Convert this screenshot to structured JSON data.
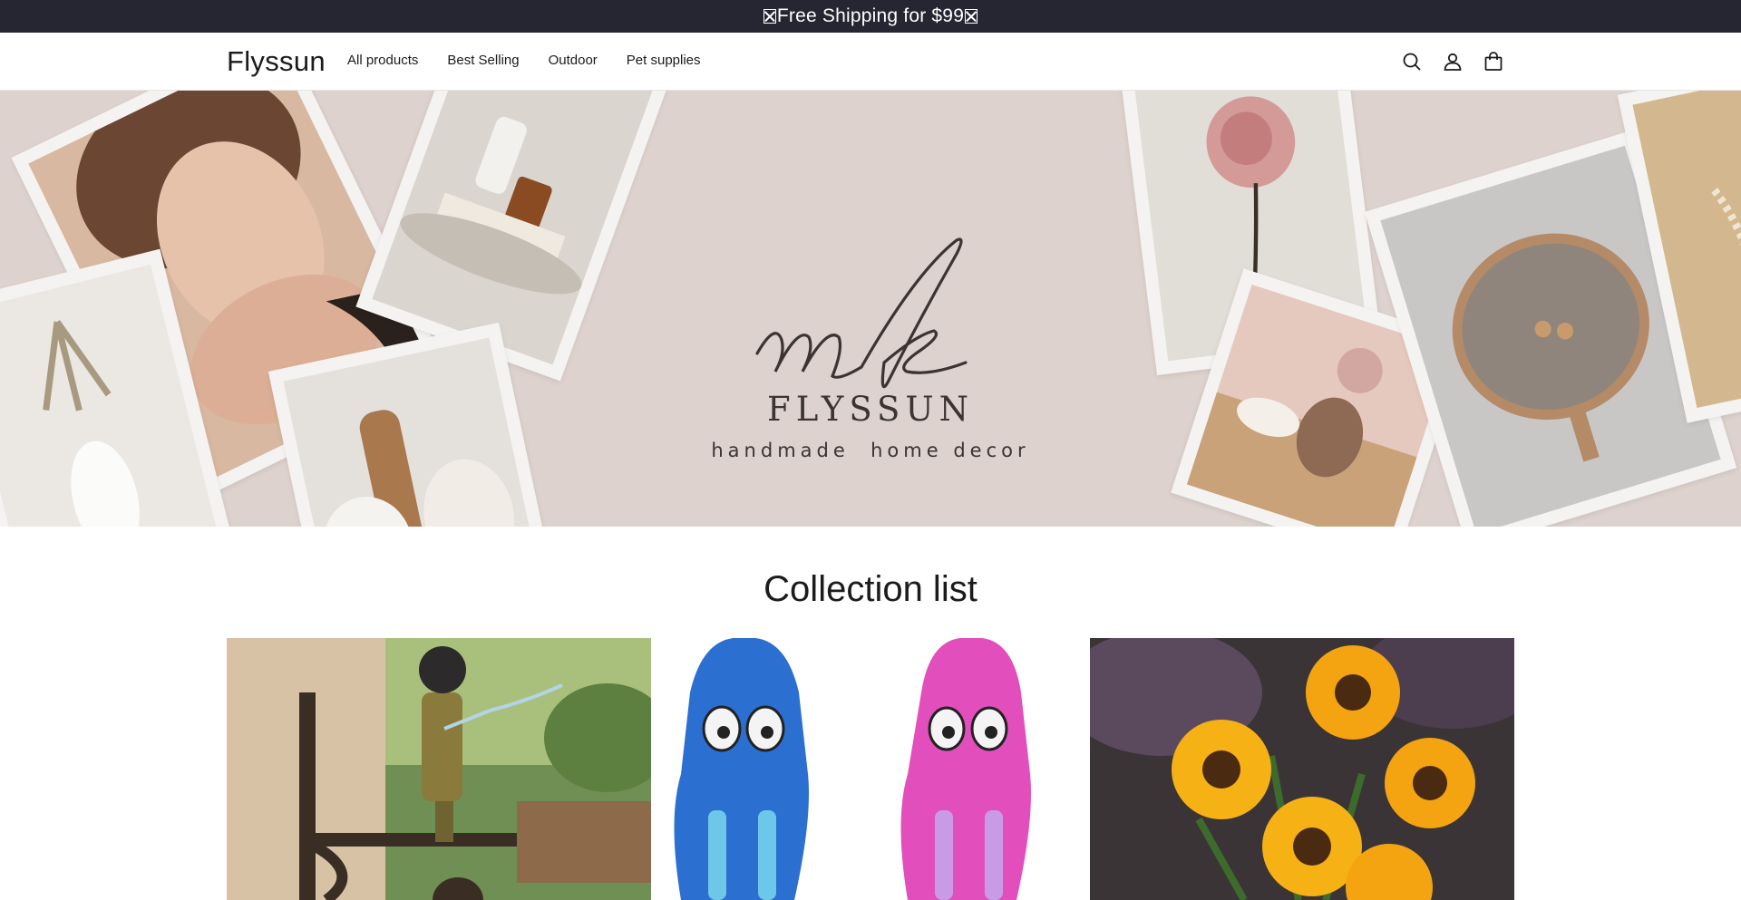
{
  "announcement": {
    "text": "Free Shipping for $99",
    "leading_glyph": "missing-glyph-box",
    "trailing_glyph": "missing-glyph-box"
  },
  "header": {
    "logo": "Flyssun",
    "nav": [
      {
        "label": "All products"
      },
      {
        "label": "Best Selling"
      },
      {
        "label": "Outdoor"
      },
      {
        "label": "Pet supplies"
      }
    ],
    "icons": [
      "search-icon",
      "account-icon",
      "cart-icon"
    ]
  },
  "hero": {
    "monogram": "mk",
    "brand_name": "FLYSSUN",
    "tagline": "handmade  home decor",
    "colors": {
      "background": "#ddd2cd",
      "text": "#3b3432"
    }
  },
  "collection": {
    "title": "Collection list",
    "cards": [
      {
        "image": "firefighter-statue-bell-bracket"
      },
      {
        "image": "octopus-plush-dog-toys-blue-pink"
      },
      {
        "image": "solar-sunflower-garden-lights"
      }
    ]
  },
  "colors": {
    "announcement_bg": "#262632",
    "text": "#1b1b1b"
  }
}
